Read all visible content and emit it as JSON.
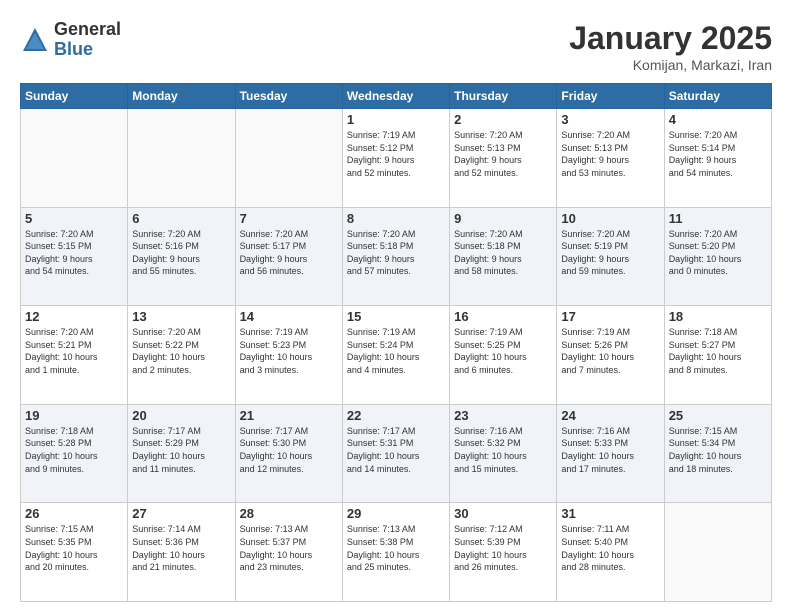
{
  "header": {
    "logo_general": "General",
    "logo_blue": "Blue",
    "title": "January 2025",
    "subtitle": "Komijan, Markazi, Iran"
  },
  "days_of_week": [
    "Sunday",
    "Monday",
    "Tuesday",
    "Wednesday",
    "Thursday",
    "Friday",
    "Saturday"
  ],
  "weeks": [
    {
      "days": [
        {
          "num": "",
          "info": ""
        },
        {
          "num": "",
          "info": ""
        },
        {
          "num": "",
          "info": ""
        },
        {
          "num": "1",
          "info": "Sunrise: 7:19 AM\nSunset: 5:12 PM\nDaylight: 9 hours\nand 52 minutes."
        },
        {
          "num": "2",
          "info": "Sunrise: 7:20 AM\nSunset: 5:13 PM\nDaylight: 9 hours\nand 52 minutes."
        },
        {
          "num": "3",
          "info": "Sunrise: 7:20 AM\nSunset: 5:13 PM\nDaylight: 9 hours\nand 53 minutes."
        },
        {
          "num": "4",
          "info": "Sunrise: 7:20 AM\nSunset: 5:14 PM\nDaylight: 9 hours\nand 54 minutes."
        }
      ]
    },
    {
      "days": [
        {
          "num": "5",
          "info": "Sunrise: 7:20 AM\nSunset: 5:15 PM\nDaylight: 9 hours\nand 54 minutes."
        },
        {
          "num": "6",
          "info": "Sunrise: 7:20 AM\nSunset: 5:16 PM\nDaylight: 9 hours\nand 55 minutes."
        },
        {
          "num": "7",
          "info": "Sunrise: 7:20 AM\nSunset: 5:17 PM\nDaylight: 9 hours\nand 56 minutes."
        },
        {
          "num": "8",
          "info": "Sunrise: 7:20 AM\nSunset: 5:18 PM\nDaylight: 9 hours\nand 57 minutes."
        },
        {
          "num": "9",
          "info": "Sunrise: 7:20 AM\nSunset: 5:18 PM\nDaylight: 9 hours\nand 58 minutes."
        },
        {
          "num": "10",
          "info": "Sunrise: 7:20 AM\nSunset: 5:19 PM\nDaylight: 9 hours\nand 59 minutes."
        },
        {
          "num": "11",
          "info": "Sunrise: 7:20 AM\nSunset: 5:20 PM\nDaylight: 10 hours\nand 0 minutes."
        }
      ]
    },
    {
      "days": [
        {
          "num": "12",
          "info": "Sunrise: 7:20 AM\nSunset: 5:21 PM\nDaylight: 10 hours\nand 1 minute."
        },
        {
          "num": "13",
          "info": "Sunrise: 7:20 AM\nSunset: 5:22 PM\nDaylight: 10 hours\nand 2 minutes."
        },
        {
          "num": "14",
          "info": "Sunrise: 7:19 AM\nSunset: 5:23 PM\nDaylight: 10 hours\nand 3 minutes."
        },
        {
          "num": "15",
          "info": "Sunrise: 7:19 AM\nSunset: 5:24 PM\nDaylight: 10 hours\nand 4 minutes."
        },
        {
          "num": "16",
          "info": "Sunrise: 7:19 AM\nSunset: 5:25 PM\nDaylight: 10 hours\nand 6 minutes."
        },
        {
          "num": "17",
          "info": "Sunrise: 7:19 AM\nSunset: 5:26 PM\nDaylight: 10 hours\nand 7 minutes."
        },
        {
          "num": "18",
          "info": "Sunrise: 7:18 AM\nSunset: 5:27 PM\nDaylight: 10 hours\nand 8 minutes."
        }
      ]
    },
    {
      "days": [
        {
          "num": "19",
          "info": "Sunrise: 7:18 AM\nSunset: 5:28 PM\nDaylight: 10 hours\nand 9 minutes."
        },
        {
          "num": "20",
          "info": "Sunrise: 7:17 AM\nSunset: 5:29 PM\nDaylight: 10 hours\nand 11 minutes."
        },
        {
          "num": "21",
          "info": "Sunrise: 7:17 AM\nSunset: 5:30 PM\nDaylight: 10 hours\nand 12 minutes."
        },
        {
          "num": "22",
          "info": "Sunrise: 7:17 AM\nSunset: 5:31 PM\nDaylight: 10 hours\nand 14 minutes."
        },
        {
          "num": "23",
          "info": "Sunrise: 7:16 AM\nSunset: 5:32 PM\nDaylight: 10 hours\nand 15 minutes."
        },
        {
          "num": "24",
          "info": "Sunrise: 7:16 AM\nSunset: 5:33 PM\nDaylight: 10 hours\nand 17 minutes."
        },
        {
          "num": "25",
          "info": "Sunrise: 7:15 AM\nSunset: 5:34 PM\nDaylight: 10 hours\nand 18 minutes."
        }
      ]
    },
    {
      "days": [
        {
          "num": "26",
          "info": "Sunrise: 7:15 AM\nSunset: 5:35 PM\nDaylight: 10 hours\nand 20 minutes."
        },
        {
          "num": "27",
          "info": "Sunrise: 7:14 AM\nSunset: 5:36 PM\nDaylight: 10 hours\nand 21 minutes."
        },
        {
          "num": "28",
          "info": "Sunrise: 7:13 AM\nSunset: 5:37 PM\nDaylight: 10 hours\nand 23 minutes."
        },
        {
          "num": "29",
          "info": "Sunrise: 7:13 AM\nSunset: 5:38 PM\nDaylight: 10 hours\nand 25 minutes."
        },
        {
          "num": "30",
          "info": "Sunrise: 7:12 AM\nSunset: 5:39 PM\nDaylight: 10 hours\nand 26 minutes."
        },
        {
          "num": "31",
          "info": "Sunrise: 7:11 AM\nSunset: 5:40 PM\nDaylight: 10 hours\nand 28 minutes."
        },
        {
          "num": "",
          "info": ""
        }
      ]
    }
  ]
}
